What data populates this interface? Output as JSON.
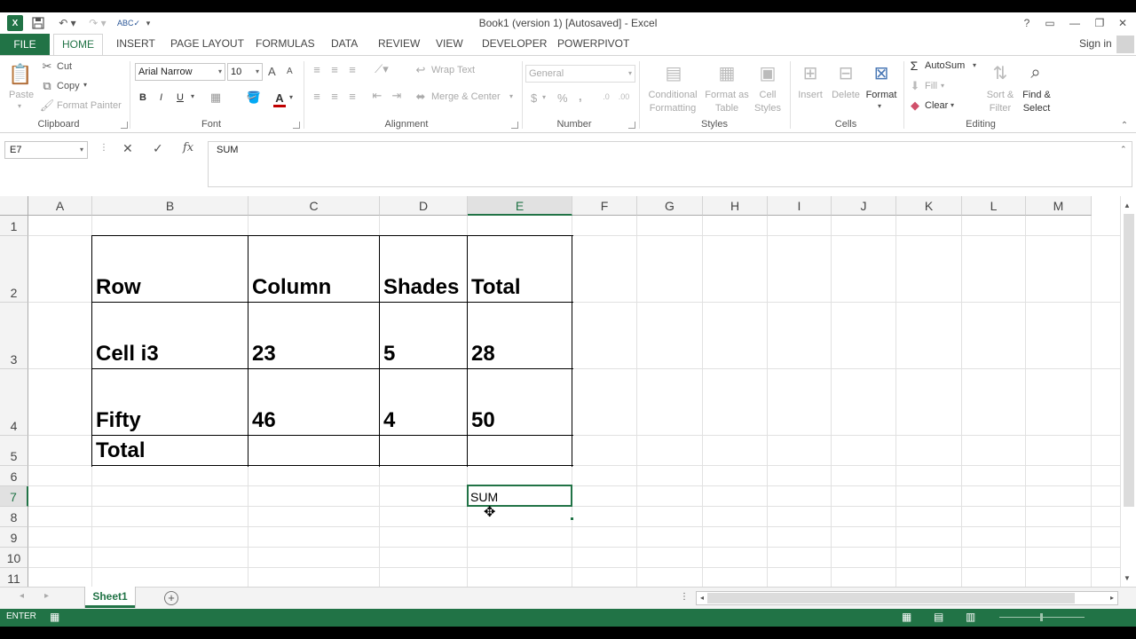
{
  "app": {
    "title": "Book1 (version 1) [Autosaved] - Excel",
    "help": "?",
    "sign_in": "Sign in"
  },
  "tabs": [
    "FILE",
    "HOME",
    "INSERT",
    "PAGE LAYOUT",
    "FORMULAS",
    "DATA",
    "REVIEW",
    "VIEW",
    "DEVELOPER",
    "POWERPIVOT"
  ],
  "ribbon": {
    "clipboard": {
      "paste": "Paste",
      "cut": "Cut",
      "copy": "Copy",
      "format_painter": "Format Painter",
      "label": "Clipboard"
    },
    "font": {
      "name": "Arial Narrow",
      "size": "10",
      "bold": "B",
      "italic": "I",
      "underline": "U",
      "label": "Font",
      "grow": "A",
      "shrink": "A",
      "color": "A"
    },
    "alignment": {
      "wrap_text": "Wrap Text",
      "merge_center": "Merge & Center",
      "label": "Alignment"
    },
    "number": {
      "format": "General",
      "currency": "$",
      "percent": "%",
      "comma": ",",
      "label": "Number"
    },
    "styles": {
      "conditional": [
        "Conditional",
        "Formatting"
      ],
      "format_as_table": [
        "Format as",
        "Table"
      ],
      "cell_styles": [
        "Cell",
        "Styles"
      ],
      "label": "Styles"
    },
    "cells": {
      "insert": "Insert",
      "delete": "Delete",
      "format": "Format",
      "label": "Cells"
    },
    "editing": {
      "autosum": "AutoSum",
      "fill": "Fill",
      "clear": "Clear",
      "sort": [
        "Sort &",
        "Filter"
      ],
      "find": [
        "Find &",
        "Select"
      ],
      "label": "Editing"
    }
  },
  "formula_bar": {
    "name_box": "E7",
    "content": "SUM",
    "cancel": "✕",
    "enter": "✓",
    "fx": "fx"
  },
  "columns": [
    "A",
    "B",
    "C",
    "D",
    "E",
    "F",
    "G",
    "H",
    "I",
    "J",
    "K",
    "L",
    "M"
  ],
  "rows": [
    "1",
    "2",
    "3",
    "4",
    "5",
    "6",
    "7",
    "8",
    "9",
    "10",
    "11"
  ],
  "cells": {
    "B2": "Row",
    "C2": "Column",
    "D2": "Shades",
    "E2": "Total",
    "B3": "Cell i3",
    "C3": "23",
    "D3": "5",
    "E3": "28",
    "B4": "Fifty",
    "C4": "46",
    "D4": "4",
    "E4": "50",
    "B5": "Total",
    "E7": "SUM"
  },
  "sheet": {
    "tab": "Sheet1",
    "add": "+"
  },
  "status": {
    "mode": "ENTER"
  }
}
